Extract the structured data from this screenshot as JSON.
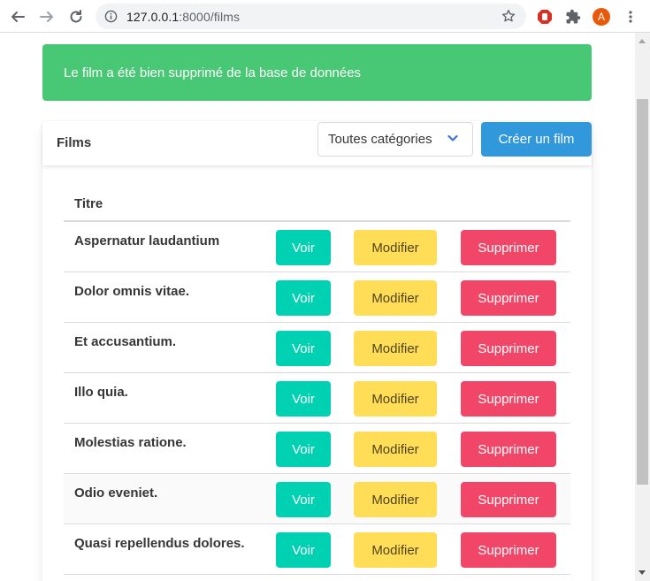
{
  "browser": {
    "url_host": "127.0.0.1",
    "url_rest": ":8000/films",
    "avatar_letter": "A"
  },
  "notification": {
    "message": "Le film a été bien supprimé de la base de données",
    "color": "#48c774"
  },
  "card": {
    "title": "Films",
    "category_select": "Toutes catégories",
    "create_button": "Créer un film"
  },
  "table": {
    "header": "Titre",
    "actions": {
      "view": "Voir",
      "edit": "Modifier",
      "delete": "Supprimer"
    },
    "rows": [
      {
        "title": "Aspernatur laudantium"
      },
      {
        "title": "Dolor omnis vitae."
      },
      {
        "title": "Et accusantium."
      },
      {
        "title": "Illo quia."
      },
      {
        "title": "Molestias ratione."
      },
      {
        "title": "Odio eveniet."
      },
      {
        "title": "Quasi repellendus dolores."
      }
    ]
  },
  "colors": {
    "primary": "#00d1b2",
    "warning": "#ffdd57",
    "danger": "#f14668",
    "info": "#3298dc"
  }
}
